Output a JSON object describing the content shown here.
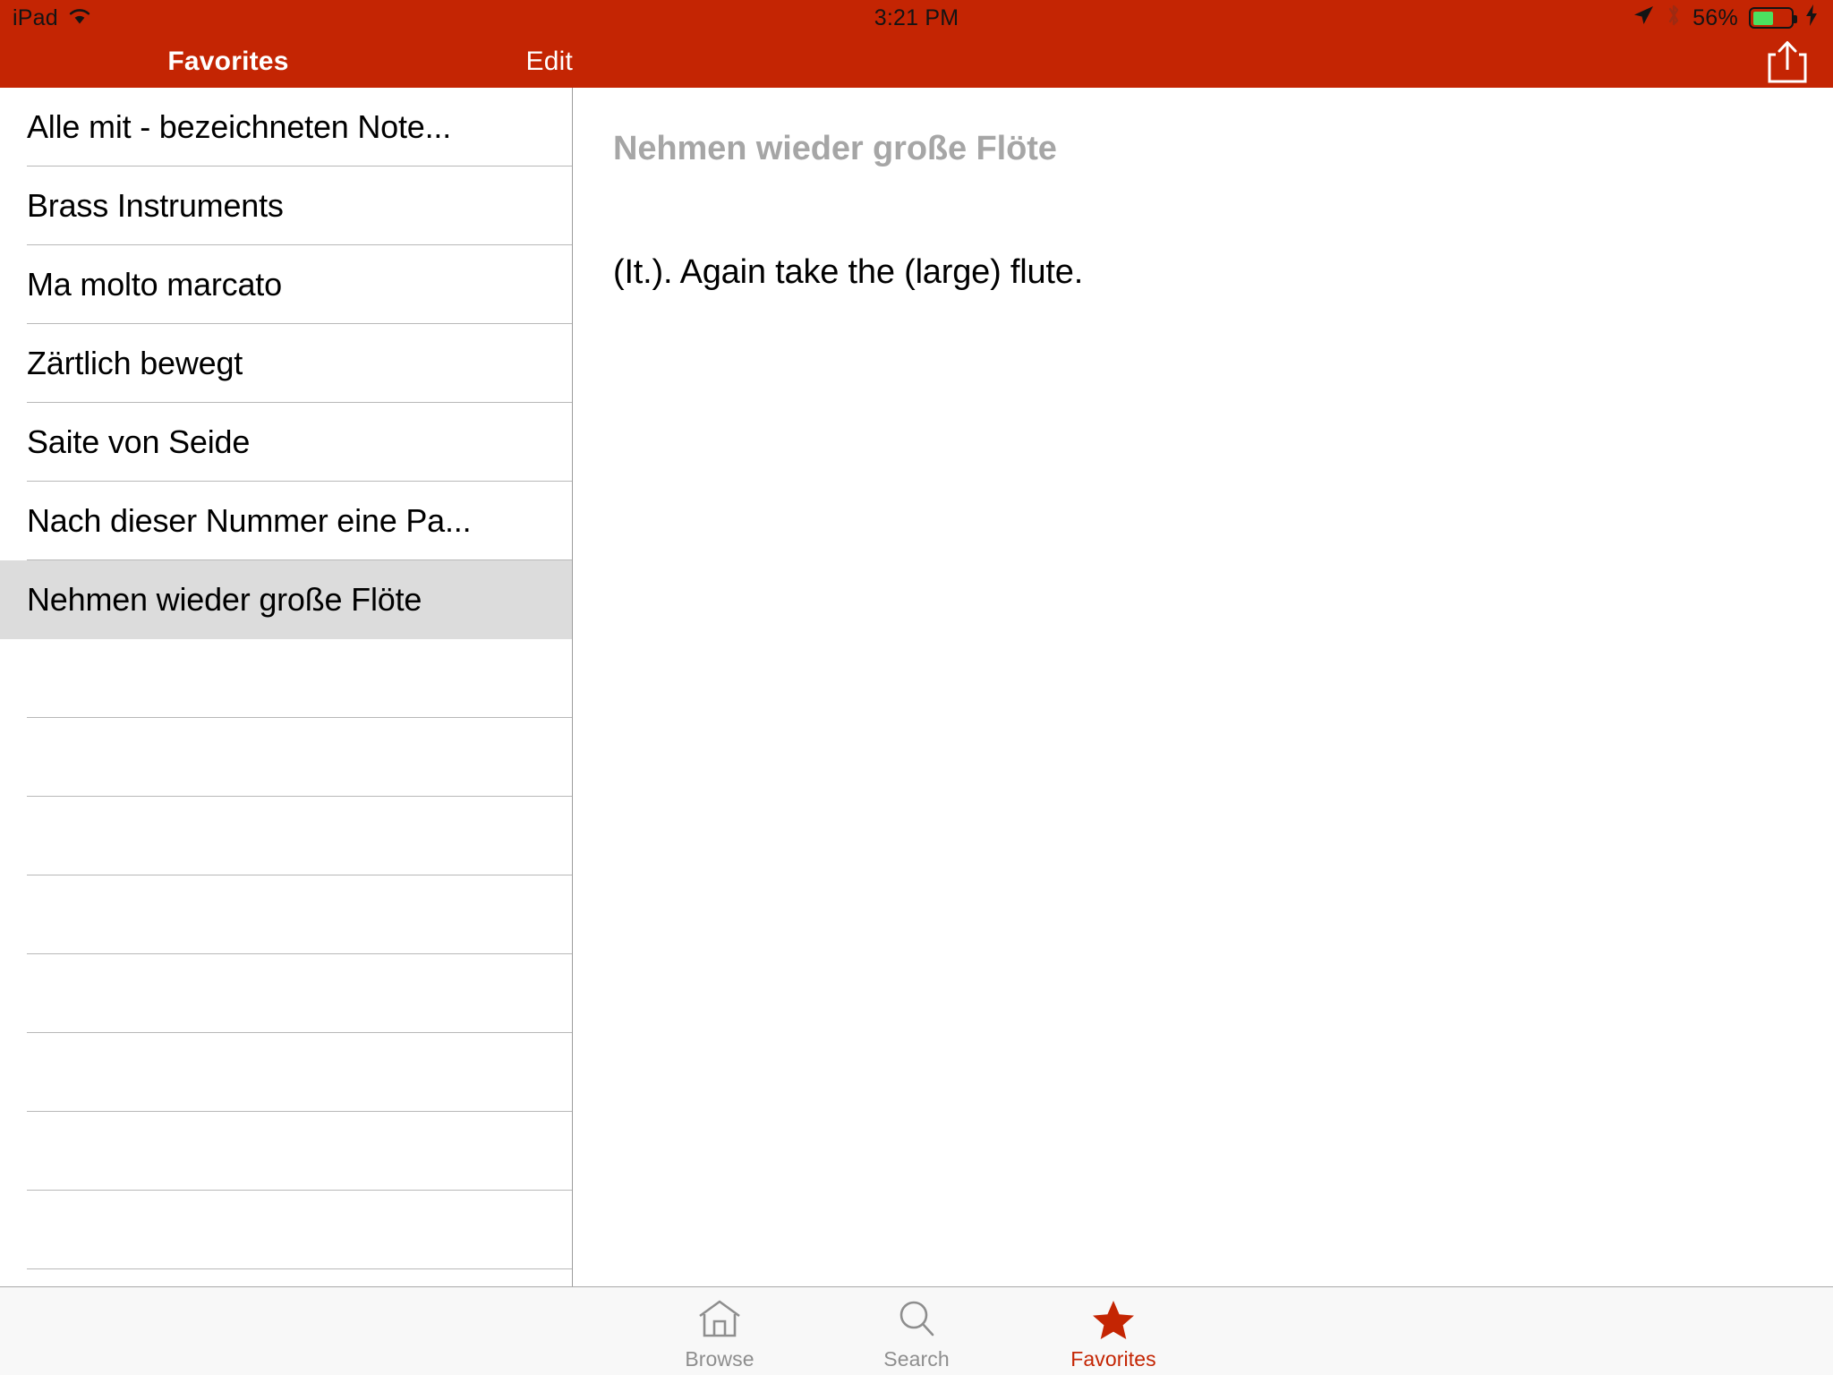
{
  "status_bar": {
    "device": "iPad",
    "wifi_icon": "wifi-icon",
    "time": "3:21 PM",
    "location_icon": "location-arrow-icon",
    "bluetooth_icon": "bluetooth-icon",
    "battery_percent": "56%",
    "battery_level": 56,
    "charging_icon": "lightning-bolt-icon",
    "battery_color": "#4ce060",
    "text_color": "#141414"
  },
  "nav_bar": {
    "title": "Favorites",
    "edit_label": "Edit",
    "share_icon": "share-icon",
    "background_color": "#c42503",
    "title_color": "#ffffff"
  },
  "sidebar": {
    "items": [
      {
        "label": "Alle mit - bezeichneten Note...",
        "selected": false
      },
      {
        "label": "Brass Instruments",
        "selected": false
      },
      {
        "label": "Ma molto marcato",
        "selected": false
      },
      {
        "label": "Zärtlich bewegt",
        "selected": false
      },
      {
        "label": "Saite von Seide",
        "selected": false
      },
      {
        "label": "Nach dieser Nummer eine Pa...",
        "selected": false
      },
      {
        "label": "Nehmen wieder große Flöte",
        "selected": true
      }
    ],
    "empty_row_count": 8,
    "selected_background": "#dcdcdc"
  },
  "detail": {
    "heading": "Nehmen wieder große Flöte",
    "heading_color": "#a6a6a6",
    "body": "(It.). Again take the (large) flute."
  },
  "tab_bar": {
    "items": [
      {
        "label": "Browse",
        "icon": "house-icon",
        "active": false
      },
      {
        "label": "Search",
        "icon": "magnifier-icon",
        "active": false
      },
      {
        "label": "Favorites",
        "icon": "star-icon",
        "active": true
      }
    ],
    "active_color": "#c42503",
    "inactive_color": "#8e8e8e"
  }
}
